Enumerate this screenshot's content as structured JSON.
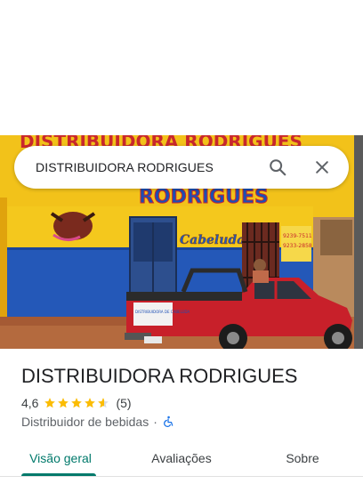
{
  "search": {
    "query": "DISTRIBUIDORA RODRIGUES",
    "search_icon": "search-icon",
    "close_icon": "close-icon"
  },
  "hero": {
    "photo_subject": "storefront-photo",
    "sign_text": "RODRIGUES",
    "sign_top_text": "DISTRIBUIDORA RODRIGUES",
    "wall_text": "Cabeluda",
    "phone_lines": [
      "9239-7511",
      "9233-2858"
    ],
    "truck_decal": "DISTRIBUIDORA DE CABELUDA"
  },
  "place": {
    "name": "DISTRIBUIDORA RODRIGUES",
    "rating": "4,6",
    "rating_stars": 4.6,
    "review_count": "(5)",
    "category": "Distribuidor de bebidas",
    "separator": "·",
    "accessibility_icon": "wheelchair-icon"
  },
  "tabs": [
    {
      "label": "Visão geral",
      "active": true
    },
    {
      "label": "Avaliações",
      "active": false
    },
    {
      "label": "Sobre",
      "active": false
    }
  ],
  "colors": {
    "accent": "#00796b",
    "star": "#fbbc04",
    "wheelchair": "#1a73e8"
  }
}
